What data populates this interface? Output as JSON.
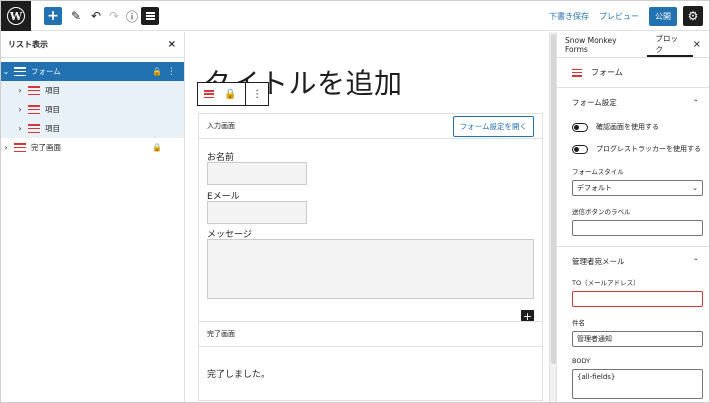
{
  "toolbar": {
    "save_draft": "下書き保存",
    "preview": "プレビュー",
    "publish": "公開",
    "add_symbol": "+"
  },
  "list_view": {
    "title": "リスト表示",
    "close": "×",
    "items": [
      {
        "label": "フォーム",
        "expanded": true,
        "selected": true,
        "locked": true
      },
      {
        "label": "項目"
      },
      {
        "label": "項目"
      },
      {
        "label": "項目"
      },
      {
        "label": "完了画面",
        "locked": true
      }
    ]
  },
  "editor": {
    "title": "タイトルを追加",
    "form_block": {
      "header": "入力画面",
      "open_settings_button": "フォーム設定を開く",
      "fields": [
        {
          "label": "お名前"
        },
        {
          "label": "Eメール"
        },
        {
          "label": "メッセージ"
        }
      ]
    },
    "complete_block": {
      "header": "完了画面",
      "text": "完了しました。"
    }
  },
  "sidebar": {
    "tabs": [
      "Snow Monkey Forms",
      "ブロック"
    ],
    "active_tab": "ブロック",
    "close": "×",
    "block_name": "フォーム",
    "form_settings": {
      "title": "フォーム設定",
      "toggle_confirm": "確認画面を使用する",
      "toggle_progress": "プログレストラッカーを使用する",
      "style_label": "フォームスタイル",
      "style_value": "デフォルト",
      "submit_label": "送信ボタンのラベル",
      "submit_value": ""
    },
    "admin_mail": {
      "title": "管理者宛メール",
      "to_label": "TO（メールアドレス）",
      "to_value": "",
      "subject_label": "件名",
      "subject_value": "管理者通知",
      "body_label": "BODY",
      "body_value": "{all-fields}"
    }
  }
}
